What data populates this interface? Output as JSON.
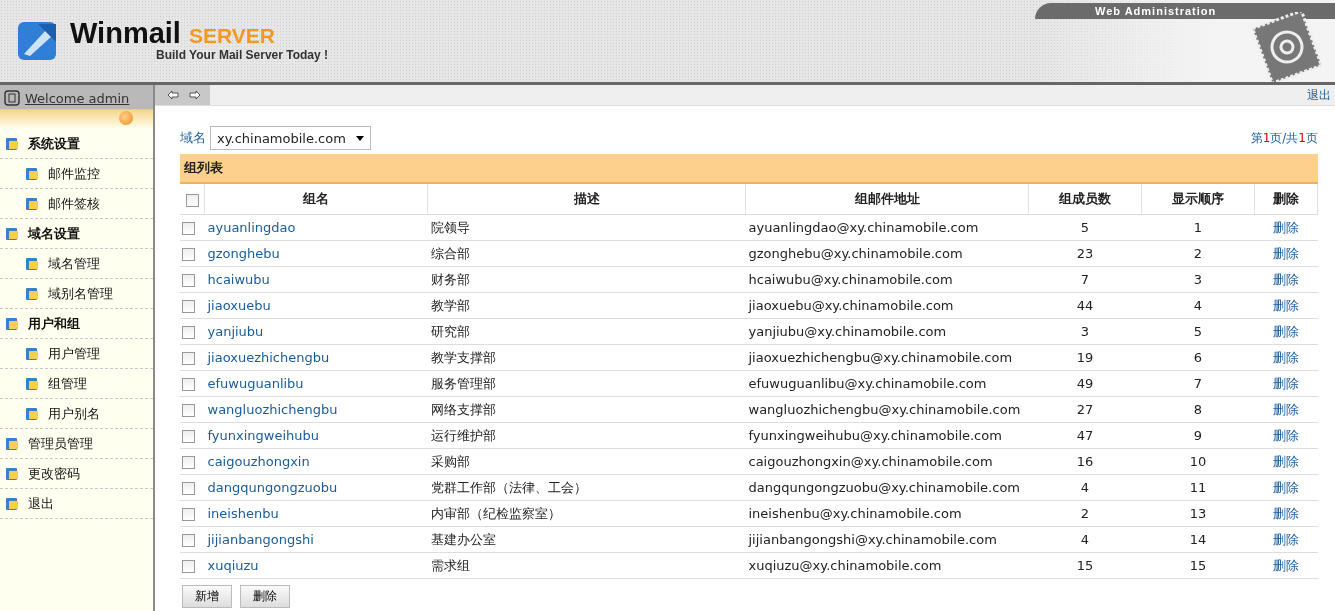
{
  "header": {
    "brand": "Winmail",
    "brand_suffix": "SERVER",
    "tagline": "Build Your Mail Server Today !",
    "banner": "Web Administration"
  },
  "sidebar": {
    "welcome": "Welcome admin",
    "items": [
      {
        "label": "系统设置",
        "kind": "section",
        "children": [
          {
            "label": "邮件监控"
          },
          {
            "label": "邮件签核"
          }
        ]
      },
      {
        "label": "域名设置",
        "kind": "section",
        "children": [
          {
            "label": "域名管理"
          },
          {
            "label": "域别名管理"
          }
        ]
      },
      {
        "label": "用户和组",
        "kind": "section",
        "children": [
          {
            "label": "用户管理"
          },
          {
            "label": "组管理"
          },
          {
            "label": "用户别名"
          }
        ]
      },
      {
        "label": "管理员管理",
        "kind": "link"
      },
      {
        "label": "更改密码",
        "kind": "link"
      },
      {
        "label": "退出",
        "kind": "link"
      }
    ]
  },
  "toolbar": {
    "logout": "退出"
  },
  "filter": {
    "label": "域名",
    "value": "xy.chinamobile.com"
  },
  "pager": "第**1**页/共**1**页",
  "table": {
    "title": "组列表",
    "select_all_checked": false,
    "columns": [
      "组名",
      "描述",
      "组邮件地址",
      "组成员数",
      "显示顺序",
      "删除"
    ],
    "rows": [
      {
        "checked": false,
        "name": "ayuanlingdao",
        "description": "院领导",
        "email": "ayuanlingdao@xy.chinamobile.com",
        "members": "5",
        "order": "1",
        "action": "删除"
      },
      {
        "checked": false,
        "name": "gzonghebu",
        "description": "综合部",
        "email": "gzonghebu@xy.chinamobile.com",
        "members": "23",
        "order": "2",
        "action": "删除"
      },
      {
        "checked": false,
        "name": "hcaiwubu",
        "description": "财务部",
        "email": "hcaiwubu@xy.chinamobile.com",
        "members": "7",
        "order": "3",
        "action": "删除"
      },
      {
        "checked": false,
        "name": "jiaoxuebu",
        "description": "教学部",
        "email": "jiaoxuebu@xy.chinamobile.com",
        "members": "44",
        "order": "4",
        "action": "删除"
      },
      {
        "checked": false,
        "name": "yanjiubu",
        "description": "研究部",
        "email": "yanjiubu@xy.chinamobile.com",
        "members": "3",
        "order": "5",
        "action": "删除"
      },
      {
        "checked": false,
        "name": "jiaoxuezhichengbu",
        "description": "教学支撑部",
        "email": "jiaoxuezhichengbu@xy.chinamobile.com",
        "members": "19",
        "order": "6",
        "action": "删除"
      },
      {
        "checked": false,
        "name": "efuwuguanlibu",
        "description": "服务管理部",
        "email": "efuwuguanlibu@xy.chinamobile.com",
        "members": "49",
        "order": "7",
        "action": "删除"
      },
      {
        "checked": false,
        "name": "wangluozhichengbu",
        "description": "网络支撑部",
        "email": "wangluozhichengbu@xy.chinamobile.com",
        "members": "27",
        "order": "8",
        "action": "删除"
      },
      {
        "checked": false,
        "name": "fyunxingweihubu",
        "description": "运行维护部",
        "email": "fyunxingweihubu@xy.chinamobile.com",
        "members": "47",
        "order": "9",
        "action": "删除"
      },
      {
        "checked": false,
        "name": "caigouzhongxin",
        "description": "采购部",
        "email": "caigouzhongxin@xy.chinamobile.com",
        "members": "16",
        "order": "10",
        "action": "删除"
      },
      {
        "checked": false,
        "name": "dangqungongzuobu",
        "description": "党群工作部（法律、工会）",
        "email": "dangqungongzuobu@xy.chinamobile.com",
        "members": "4",
        "order": "11",
        "action": "删除"
      },
      {
        "checked": false,
        "name": "ineishenbu",
        "description": "内审部（纪检监察室）",
        "email": "ineishenbu@xy.chinamobile.com",
        "members": "2",
        "order": "13",
        "action": "删除"
      },
      {
        "checked": false,
        "name": "jijianbangongshi",
        "description": "基建办公室",
        "email": "jijianbangongshi@xy.chinamobile.com",
        "members": "4",
        "order": "14",
        "action": "删除"
      },
      {
        "checked": false,
        "name": "xuqiuzu",
        "description": "需求组",
        "email": "xuqiuzu@xy.chinamobile.com",
        "members": "15",
        "order": "15",
        "action": "删除"
      }
    ]
  },
  "buttons": [
    "新增",
    "删除"
  ]
}
